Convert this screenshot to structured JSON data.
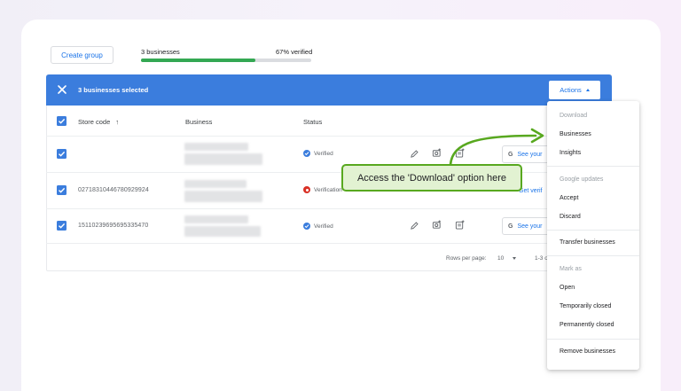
{
  "toolbar": {
    "create_group_label": "Create group",
    "progress_left": "3 businesses",
    "progress_right": "67% verified",
    "progress_fraction": 0.67
  },
  "selection_bar": {
    "text": "3 businesses selected",
    "actions_label": "Actions",
    "close_icon": "close-icon"
  },
  "table": {
    "headers": {
      "store_code": "Store code",
      "business": "Business",
      "status": "Status"
    },
    "rows": [
      {
        "store_code": "",
        "status": "Verified",
        "status_type": "verified",
        "action_label": "See your"
      },
      {
        "store_code": "02718310446780929924",
        "status": "Verification",
        "status_type": "needs-verification",
        "action_label": "Get verif"
      },
      {
        "store_code": "15110239695695335470",
        "status": "Verified",
        "status_type": "verified",
        "action_label": "See your"
      }
    ],
    "footer": {
      "rows_per_page_label": "Rows per page:",
      "rows_per_page_value": "10",
      "range": "1-3 o"
    }
  },
  "menu": {
    "download_header": "Download",
    "businesses": "Businesses",
    "insights": "Insights",
    "google_updates_header": "Google updates",
    "accept": "Accept",
    "discard": "Discard",
    "transfer": "Transfer businesses",
    "mark_as_header": "Mark as",
    "open": "Open",
    "temporarily_closed": "Temporarily closed",
    "permanently_closed": "Permanently closed",
    "remove": "Remove businesses"
  },
  "callout": {
    "text": "Access the 'Download' option here"
  },
  "colors": {
    "accent": "#3b7ddd",
    "progress": "#34a853",
    "callout_border": "#58a81f",
    "callout_bg": "#e2f2d2",
    "verified": "#1a73e8",
    "warning": "#d93025"
  }
}
